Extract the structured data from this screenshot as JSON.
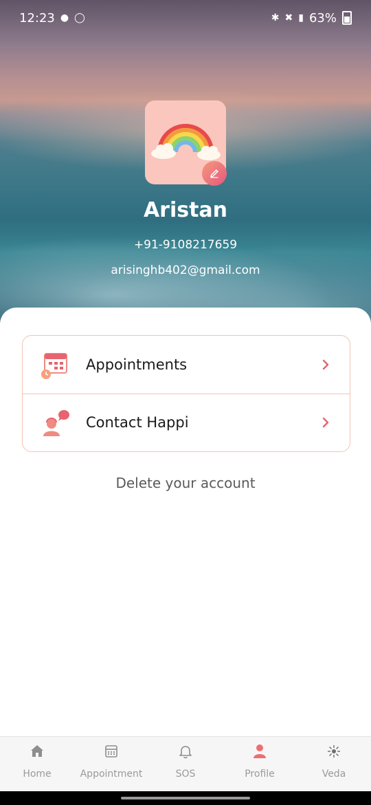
{
  "status_bar": {
    "time": "12:23",
    "battery": "63%"
  },
  "profile": {
    "name": "Aristan",
    "phone": "+91-9108217659",
    "email": "arisinghb402@gmail.com",
    "avatar_icon": "rainbow-icon",
    "edit_icon": "pencil-icon"
  },
  "menu": [
    {
      "label": "Appointments",
      "icon": "calendar-icon"
    },
    {
      "label": "Contact Happi",
      "icon": "support-chat-icon"
    }
  ],
  "delete_label": "Delete your account",
  "tabs": [
    {
      "label": "Home",
      "icon": "home-icon"
    },
    {
      "label": "Appointment",
      "icon": "calendar-icon"
    },
    {
      "label": "SOS",
      "icon": "bell-icon"
    },
    {
      "label": "Profile",
      "icon": "person-icon"
    },
    {
      "label": "Veda",
      "icon": "veda-icon"
    }
  ],
  "colors": {
    "accent": "#e8636f",
    "card_border": "#f2c3b3",
    "avatar_bg": "#fbc6bd",
    "tab_inactive": "#9a9a9a"
  }
}
